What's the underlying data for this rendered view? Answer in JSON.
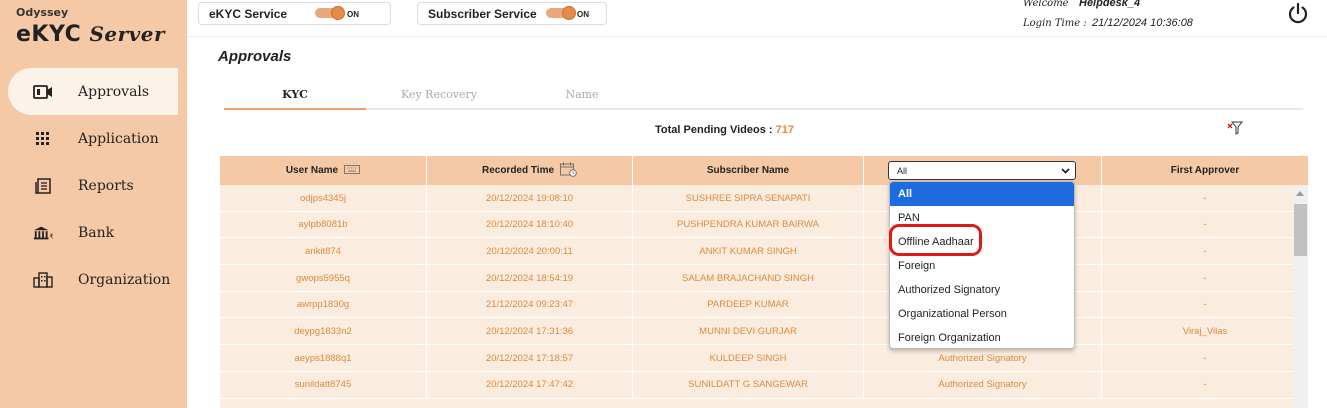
{
  "brand": {
    "small": "Odyssey",
    "big": "eKYC",
    "server": "Server"
  },
  "sidebar": {
    "items": [
      {
        "label": "Approvals",
        "icon": "video-icon",
        "active": true
      },
      {
        "label": "Application",
        "icon": "grid-icon",
        "active": false
      },
      {
        "label": "Reports",
        "icon": "report-icon",
        "active": false
      },
      {
        "label": "Bank",
        "icon": "bank-icon",
        "active": false
      },
      {
        "label": "Organization",
        "icon": "building-icon",
        "active": false
      }
    ]
  },
  "header": {
    "ekyc_service": {
      "label": "eKYC Service",
      "state": "ON"
    },
    "subscriber_service": {
      "label": "Subscriber Service",
      "state": "ON"
    },
    "welcome_label": "Welcome",
    "welcome_user": "Helpdesk_4",
    "login_label": "Login Time :",
    "login_time": "21/12/2024 10:36:08"
  },
  "page": {
    "title": "Approvals",
    "tabs": [
      {
        "label": "KYC",
        "active": true
      },
      {
        "label": "Key Recovery",
        "active": false
      },
      {
        "label": "Name",
        "active": false
      }
    ],
    "pending_label": "Total Pending Videos :",
    "pending_count": "717"
  },
  "table": {
    "columns": [
      "User Name",
      "Recorded Time",
      "Subscriber Name",
      "",
      "First Approver"
    ],
    "filter_value": "All",
    "rows": [
      {
        "user": "odjps4345j",
        "time": "20/12/2024 19:08:10",
        "name": "SUSHREE SIPRA SENAPATI",
        "type": "",
        "approver": "-"
      },
      {
        "user": "aylpb8081b",
        "time": "20/12/2024 18:10:40",
        "name": "PUSHPENDRA KUMAR BAIRWA",
        "type": "",
        "approver": "-"
      },
      {
        "user": "ankit874",
        "time": "20/12/2024 20:00:11",
        "name": "ANKIT KUMAR SINGH",
        "type": "",
        "approver": "-"
      },
      {
        "user": "gwops5955q",
        "time": "20/12/2024 18:54:19",
        "name": "SALAM BRAJACHAND SINGH",
        "type": "",
        "approver": "-"
      },
      {
        "user": "awrpp1830g",
        "time": "21/12/2024 09:23:47",
        "name": "PARDEEP KUMAR",
        "type": "",
        "approver": "-"
      },
      {
        "user": "deypg1833n2",
        "time": "20/12/2024 17:31:36",
        "name": "MUNNI DEVI GURJAR",
        "type": "",
        "approver": "Viraj_Vilas"
      },
      {
        "user": "aeyps1888q1",
        "time": "20/12/2024 17:18:57",
        "name": "KULDEEP SINGH",
        "type": "Authorized Signatory",
        "approver": "-"
      },
      {
        "user": "sunildatt8745",
        "time": "20/12/2024 17:47:42",
        "name": "SUNILDATT G SANGEWAR",
        "type": "Authorized Signatory",
        "approver": "-"
      }
    ]
  },
  "dropdown": {
    "options": [
      "All",
      "PAN",
      "Offline Aadhaar",
      "Foreign",
      "Authorized Signatory",
      "Organizational Person",
      "Foreign Organization"
    ],
    "selected": "All",
    "highlighted": "Offline Aadhaar"
  },
  "colors": {
    "accent": "#f6c9a6",
    "text_orange": "#e08a3c",
    "select_blue": "#1e6be0",
    "highlight_red": "#e01818"
  }
}
